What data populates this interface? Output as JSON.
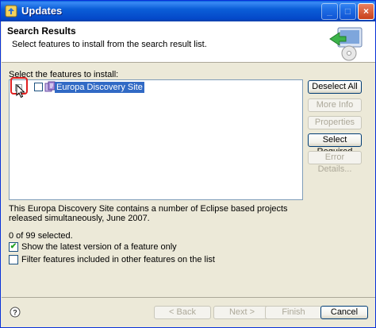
{
  "window": {
    "title": "Updates",
    "minimize_glyph": "_",
    "maximize_glyph": "□",
    "close_glyph": "×"
  },
  "header": {
    "title": "Search Results",
    "description": "Select features to install from the search result list."
  },
  "tree": {
    "label": "Select the features to install:",
    "expander_glyph": "+",
    "items": [
      {
        "label": "Europa Discovery Site",
        "checked": false,
        "expanded": false,
        "selected": true
      }
    ]
  },
  "side_buttons": {
    "deselect_all": "Deselect All",
    "more_info": "More Info",
    "properties": "Properties",
    "select_required": "Select Required",
    "error_details": "Error Details..."
  },
  "description": "This Europa Discovery Site contains a number of Eclipse based projects released simultaneously, June 2007.",
  "selection_count": "0 of 99 selected.",
  "options": {
    "latest_only": {
      "label": "Show the latest version of a feature only",
      "checked": true,
      "glyph": "✔"
    },
    "filter_included": {
      "label": "Filter features included in other features on the list",
      "checked": false
    }
  },
  "footer": {
    "back": "< Back",
    "next": "Next >",
    "finish": "Finish",
    "cancel": "Cancel"
  },
  "colors": {
    "titlebar": "#0b5ed8",
    "selection": "#316ac5",
    "highlight_ring": "#e02020",
    "window_bg": "#ece9d8"
  },
  "icons": [
    "app-icon",
    "wizard-update-icon",
    "site-icon",
    "cursor-icon",
    "help-icon"
  ]
}
